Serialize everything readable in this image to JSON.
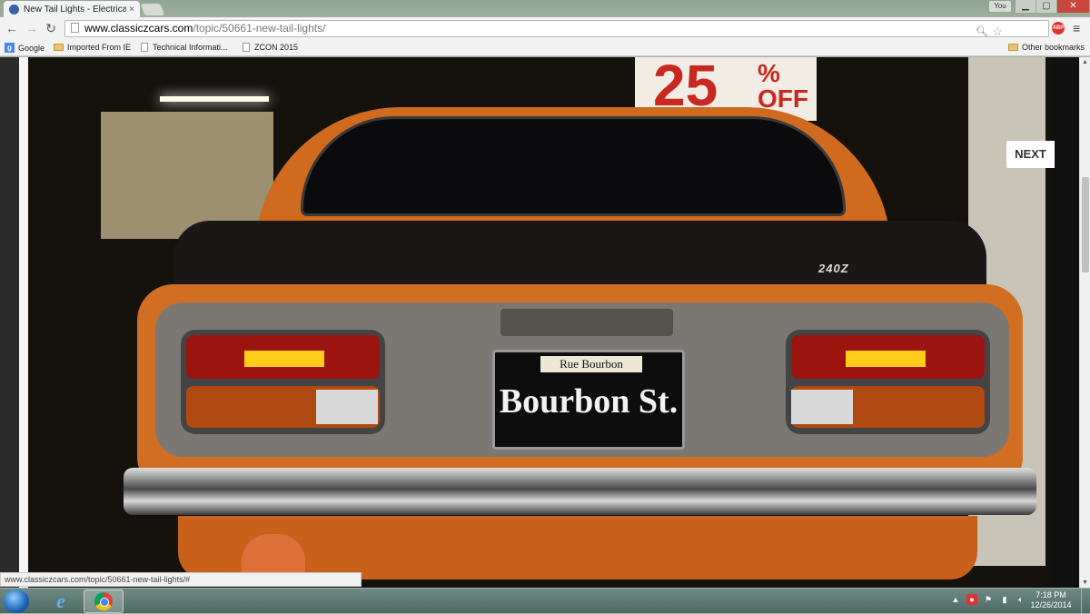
{
  "browser": {
    "tab_title": "New Tail Lights - Electrica",
    "tab_close": "×",
    "profile_label": "You",
    "window_controls": {
      "minimize": "▁",
      "maximize": "▢",
      "close": "✕"
    },
    "url_host": "www.classiczcars.com",
    "url_path": "/topic/50661-new-tail-lights/",
    "nav": {
      "back": "←",
      "forward": "→",
      "reload": "↻"
    },
    "extension_badge": "ABP",
    "menu_icon": "≡"
  },
  "bookmarks": {
    "items": [
      {
        "label": "Google",
        "icon": "google-icon"
      },
      {
        "label": "Imported From IE",
        "icon": "folder-icon"
      },
      {
        "label": "Technical Informati...",
        "icon": "page-icon"
      },
      {
        "label": "ZCON 2015",
        "icon": "page-icon"
      }
    ],
    "other": "Other bookmarks"
  },
  "photo": {
    "sign_number": "25",
    "sign_suffix": "%\nOFF",
    "model_badge": "240Z",
    "plate_top": "Rue Bourbon",
    "plate_main": "Bourbon St."
  },
  "gallery": {
    "next_label": "NEXT"
  },
  "status_url": "www.classiczcars.com/topic/50661-new-tail-lights/#",
  "taskbar": {
    "time": "7:18 PM",
    "date": "12/26/2014"
  }
}
